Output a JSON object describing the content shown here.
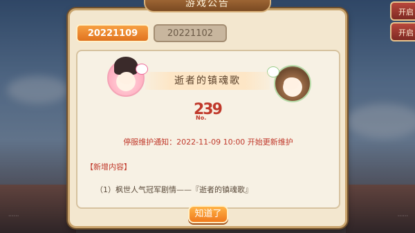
{
  "window": {
    "title": "游戏公告"
  },
  "side_buttons": [
    "开启",
    "开启"
  ],
  "tabs": [
    {
      "label": "20221109",
      "active": true
    },
    {
      "label": "20221102",
      "active": false
    }
  ],
  "announcement": {
    "headline": "逝者的镇魂歌",
    "no_number": "239",
    "no_label": "No.",
    "notice": "停服维护通知：2022-11-09 10:00 开始更新维护",
    "section_title": "【新增内容】",
    "items": [
      "（1）枫世人气冠军剧情——『逝者的镇魂歌』"
    ]
  },
  "buttons": {
    "ok": "知道了"
  },
  "colors": {
    "accent": "#f0791c",
    "notice_red": "#c0392b"
  }
}
